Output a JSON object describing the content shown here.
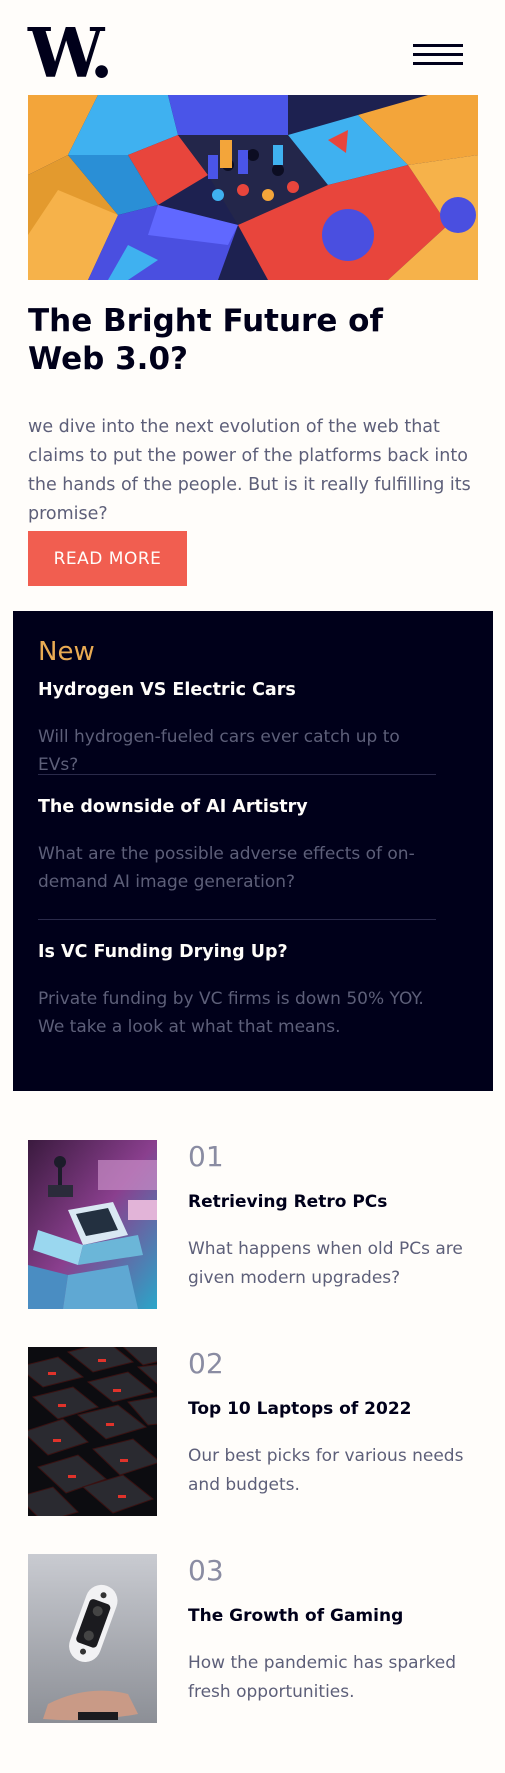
{
  "brand": {
    "logo_text": "W."
  },
  "hero": {
    "title": "The Bright Future of Web 3.0?",
    "description": "we dive into the next evolution of the web that claims to put the power of the platforms back into the hands of the people. But is it really fulfilling its promise?",
    "cta_label": "READ MORE"
  },
  "new_section": {
    "heading": "New",
    "items": [
      {
        "title": "Hydrogen VS Electric Cars",
        "description": "Will hydrogen-fueled cars ever catch up to EVs?"
      },
      {
        "title": "The downside of AI Artistry",
        "description": "What are the possible adverse effects of on-demand AI image generation?"
      },
      {
        "title": "Is VC Funding Drying Up?",
        "description": "Private funding by VC firms is down 50% YOY. We take a look at what that means."
      }
    ]
  },
  "articles": [
    {
      "number": "01",
      "title": "Retrieving Retro PCs",
      "description": "What happens when old PCs are given modern upgrades?"
    },
    {
      "number": "02",
      "title": "Top 10 Laptops of 2022",
      "description": "Our best picks for various needs and budgets."
    },
    {
      "number": "03",
      "title": "The Growth of Gaming",
      "description": "How the pandemic has sparked fresh opportunities."
    }
  ],
  "colors": {
    "background": "#fffdfa",
    "dark": "#00001a",
    "accent_red": "#f15e50",
    "accent_orange": "#e9ab53",
    "muted_text": "#5d5f79"
  },
  "icons": {
    "menu": "hamburger-menu-icon"
  }
}
